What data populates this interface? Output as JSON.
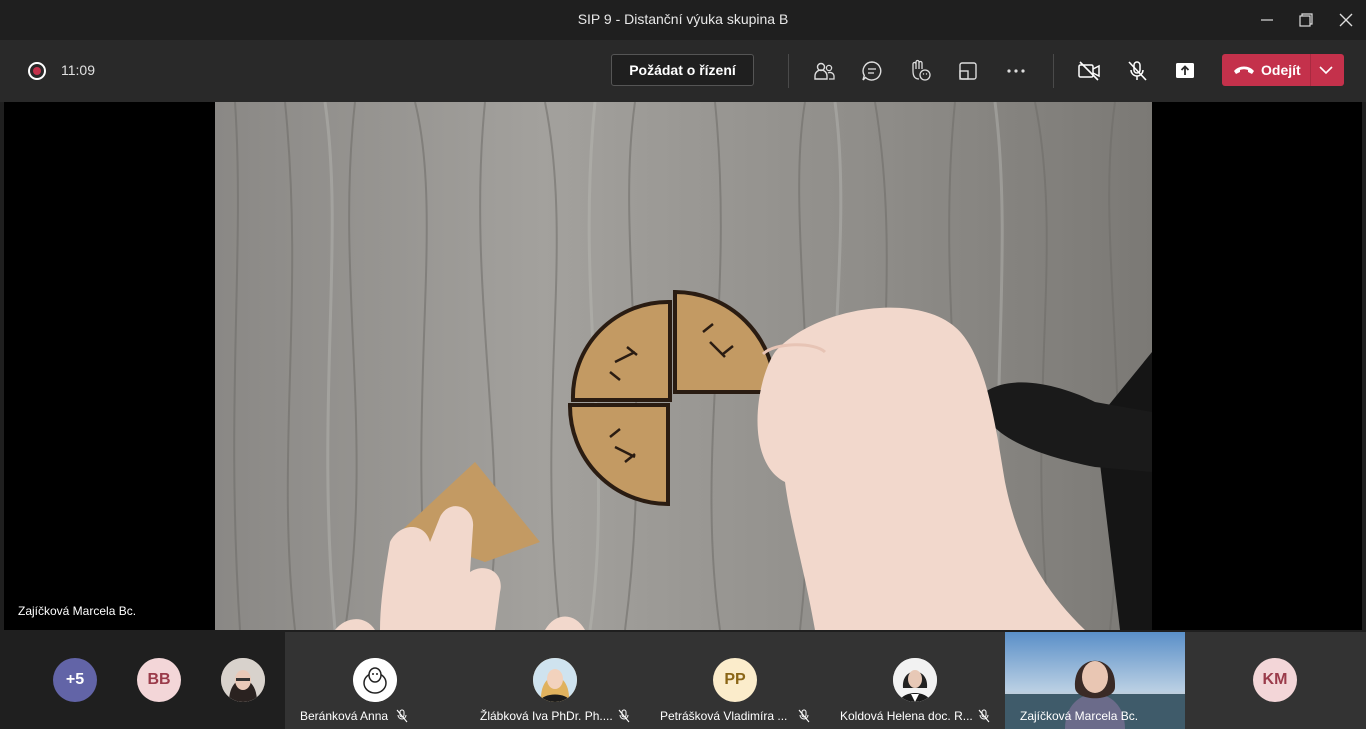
{
  "window": {
    "title": "SIP 9 - Distanční výuka skupina B"
  },
  "toolbar": {
    "time": "11:09",
    "request_control_label": "Požádat o řízení",
    "leave_label": "Odejít",
    "icons": [
      "participants-icon",
      "chat-icon",
      "reactions-icon",
      "share-tray-icon",
      "more-options-icon",
      "camera-off-icon",
      "mic-off-icon",
      "share-screen-icon"
    ]
  },
  "stage": {
    "speaker_name": "Zajíčková Marcela Bc."
  },
  "participants": {
    "overflow_count": "+5",
    "items": [
      {
        "initials": "BB",
        "name": ""
      },
      {
        "initials": "",
        "name": ""
      },
      {
        "initials": "",
        "name": "Beránková Anna"
      },
      {
        "initials": "",
        "name": "Žlábková Iva PhDr. Ph...."
      },
      {
        "initials": "PP",
        "name": "Petrášková Vladimíra ..."
      },
      {
        "initials": "",
        "name": "Koldová Helena doc. R..."
      },
      {
        "initials": "",
        "name": "Zajíčková Marcela Bc."
      },
      {
        "initials": "KM",
        "name": ""
      }
    ]
  },
  "colors": {
    "leave": "#c4314b",
    "overflow_avatar": "#6264a7",
    "toolbar": "#292929"
  }
}
